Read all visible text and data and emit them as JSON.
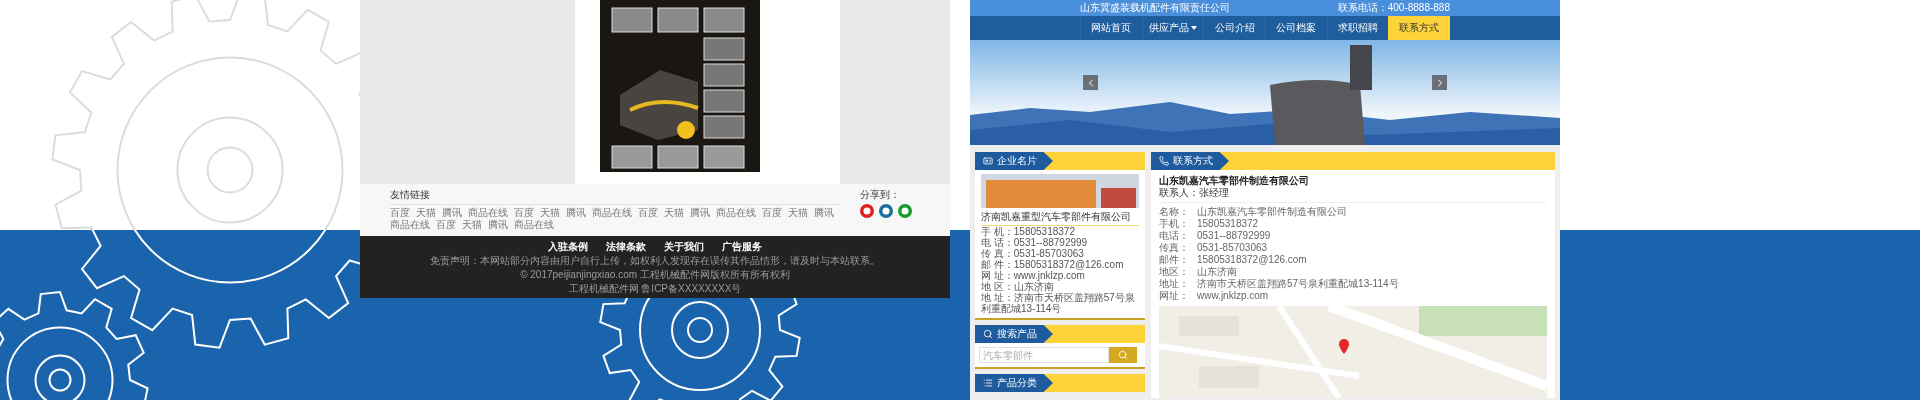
{
  "left_site": {
    "friend_links": {
      "title": "友情链接",
      "links": [
        "百度",
        "天猫",
        "腾讯",
        "商品在线",
        "百度",
        "天猫",
        "腾讯",
        "商品在线",
        "百度",
        "天猫",
        "腾讯",
        "商品在线",
        "百度",
        "天猫",
        "腾讯",
        "商品在线",
        "百度",
        "天猫",
        "腾讯",
        "商品在线"
      ]
    },
    "share": {
      "label": "分享到："
    },
    "footer_nav": [
      "入驻条例",
      "法律条款",
      "关于我们",
      "广告服务"
    ],
    "footer_lines": [
      "免责声明：本网站部分内容由用户自行上传，如权利人发现存在误传其作品情形，请及时与本站联系。",
      "© 2017peijianjingxiao.com 工程机械配件网版权所有所有权利",
      "工程机械配件网  鲁ICP备XXXXXXXX号"
    ]
  },
  "right_site": {
    "company_title": "山东冀盛装载机配件有限责任公司",
    "hotline": "联系电话：400-8888-888",
    "nav": [
      {
        "label": "网站首页",
        "selected": false,
        "has_dropdown": false
      },
      {
        "label": "供应产品",
        "selected": false,
        "has_dropdown": true
      },
      {
        "label": "公司介绍",
        "selected": false,
        "has_dropdown": false
      },
      {
        "label": "公司档案",
        "selected": false,
        "has_dropdown": false
      },
      {
        "label": "求职招聘",
        "selected": false,
        "has_dropdown": false
      },
      {
        "label": "联系方式",
        "selected": true,
        "has_dropdown": false
      }
    ],
    "card": {
      "title": "企业名片",
      "company": "济南凯嘉重型汽车零部件有限公司",
      "fields": [
        "手 机：15805318372",
        "电 话：0531--88792999",
        "传 真：0531-85703063",
        "邮 件：15805318372@126.com",
        "网 址：www.jnklzp.com",
        "地 区：山东济南",
        "地 址：济南市天桥区盖翔路57号泉利重配城13-114号"
      ]
    },
    "search": {
      "title": "搜索产品",
      "placeholder": "汽车零部件"
    },
    "category": {
      "title": "产品分类"
    },
    "contact": {
      "title": "联系方式",
      "company": "山东凯嘉汽车零部件制造有限公司",
      "person": "联系人：张经理",
      "rows": [
        {
          "label": "名称：",
          "value": "山东凯嘉汽车零部件制造有限公司"
        },
        {
          "label": "手机：",
          "value": "15805318372"
        },
        {
          "label": "电话：",
          "value": "0531--88792999"
        },
        {
          "label": "传真：",
          "value": "0531-85703063"
        },
        {
          "label": "邮件：",
          "value": "15805318372@126.com"
        },
        {
          "label": "地区：",
          "value": "山东济南"
        },
        {
          "label": "地址：",
          "value": "济南市天桥区盖翔路57号泉利重配城13-114号"
        },
        {
          "label": "网址：",
          "value": "www.jnklzp.com"
        }
      ]
    }
  }
}
